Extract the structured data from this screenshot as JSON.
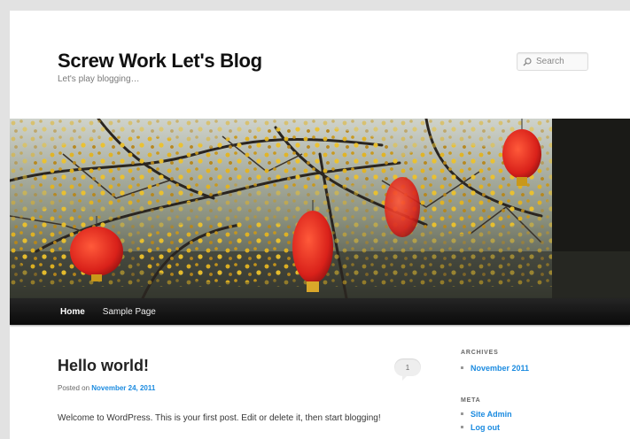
{
  "header": {
    "site_title": "Screw Work Let's Blog",
    "site_description": "Let's play blogging…",
    "search_placeholder": "Search"
  },
  "nav": {
    "items": [
      {
        "label": "Home",
        "current": true
      },
      {
        "label": "Sample Page",
        "current": false
      }
    ]
  },
  "post": {
    "title": "Hello world!",
    "posted_on_label": "Posted on",
    "date": "November 24, 2011",
    "comment_count": "1",
    "excerpt": "Welcome to WordPress. This is your first post. Edit or delete it, then start blogging!"
  },
  "sidebar": {
    "archives_title": "ARCHIVES",
    "archives": [
      "November 2011"
    ],
    "meta_title": "META",
    "meta": [
      "Site Admin",
      "Log out"
    ]
  },
  "colors": {
    "link": "#1b8be0",
    "lantern_red": "#e8291f",
    "blossom_yellow": "#e3b421",
    "nav_bg": "#111111"
  },
  "icons": {
    "search": "magnifier-icon"
  }
}
